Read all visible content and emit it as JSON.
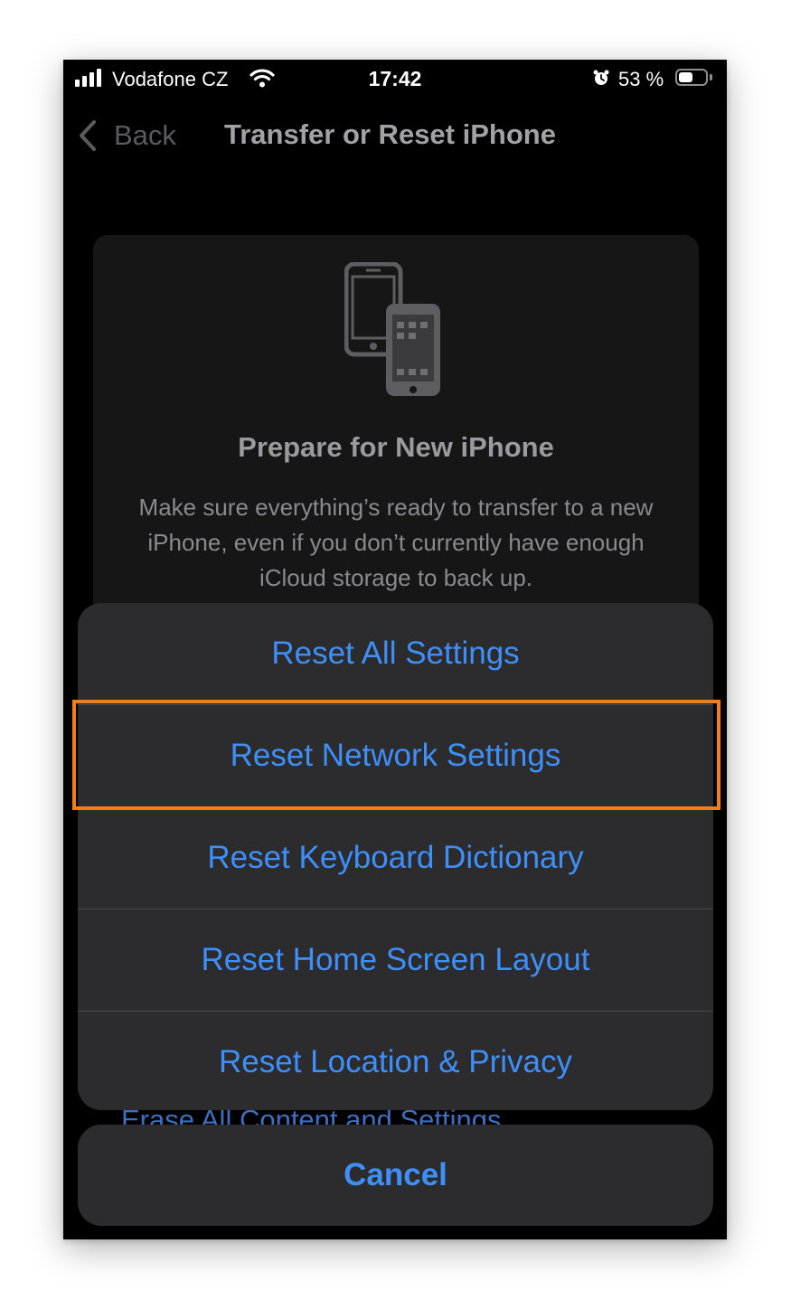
{
  "status_bar": {
    "carrier": "Vodafone CZ",
    "time": "17:42",
    "battery_percent": "53 %",
    "battery_level": 0.53,
    "icons": [
      "signal-icon",
      "wifi-icon",
      "alarm-icon",
      "battery-icon"
    ]
  },
  "nav": {
    "back_label": "Back",
    "title": "Transfer or Reset iPhone"
  },
  "card": {
    "icon": "two-phones-icon",
    "title": "Prepare for New iPhone",
    "description": "Make sure everything’s ready to transfer to a new iPhone, even if you don’t currently have enough iCloud storage to back up."
  },
  "background_partial_text": "Erase All Content and Settings",
  "action_sheet": {
    "items": [
      "Reset All Settings",
      "Reset Network Settings",
      "Reset Keyboard Dictionary",
      "Reset Home Screen Layout",
      "Reset Location & Privacy"
    ],
    "highlighted_item": "Reset Network Settings",
    "cancel_label": "Cancel"
  },
  "colors": {
    "action_blue": "#3e8ff8",
    "highlight_orange": "#f47d18",
    "sheet_bg": "#2c2c2e"
  }
}
